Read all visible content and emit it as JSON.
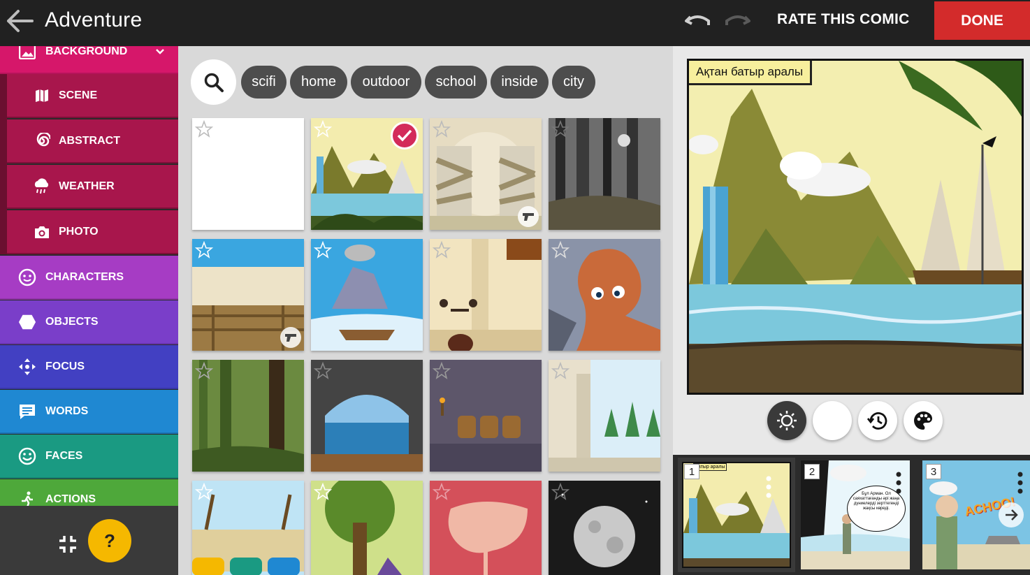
{
  "topbar": {
    "title": "Adventure",
    "rate_label": "RATE THIS COMIC",
    "done_label": "DONE",
    "back_icon": "arrow-left-icon",
    "undo_icon": "undo-icon",
    "redo_icon": "redo-icon"
  },
  "sidebar": {
    "background_label": "BACKGROUND",
    "subcategories": [
      "SCENE",
      "ABSTRACT",
      "WEATHER",
      "PHOTO"
    ],
    "categories": [
      "CHARACTERS",
      "OBJECTS",
      "FOCUS",
      "WORDS",
      "FACES",
      "ACTIONS"
    ],
    "help_label": "?",
    "colors": {
      "background": "#d6176a",
      "characters": "#a63cc4",
      "objects": "#7a3ec9",
      "focus": "#4240c2",
      "words": "#1f88d2",
      "faces": "#1a9a82",
      "actions": "#4ea83a",
      "help": "#f5b800"
    }
  },
  "gallery": {
    "tags": [
      "scifi",
      "home",
      "outdoor",
      "school",
      "inside",
      "city"
    ],
    "selected_index": 1
  },
  "editor": {
    "caption": "Ақтан батыр аралы",
    "tools": [
      "brightness-icon",
      "night-icon",
      "history-icon",
      "palette-icon"
    ]
  },
  "strip": {
    "frames": [
      {
        "number": "1"
      },
      {
        "number": "2",
        "bubble_text": "Бұл Арман. Ол саяхаттағанды әрі жаңа дүниелерді зерттегенді жақсы көреді."
      },
      {
        "number": "3",
        "sound_text": "ACHOO!"
      }
    ],
    "frame1_caption": "батыр аралы"
  }
}
